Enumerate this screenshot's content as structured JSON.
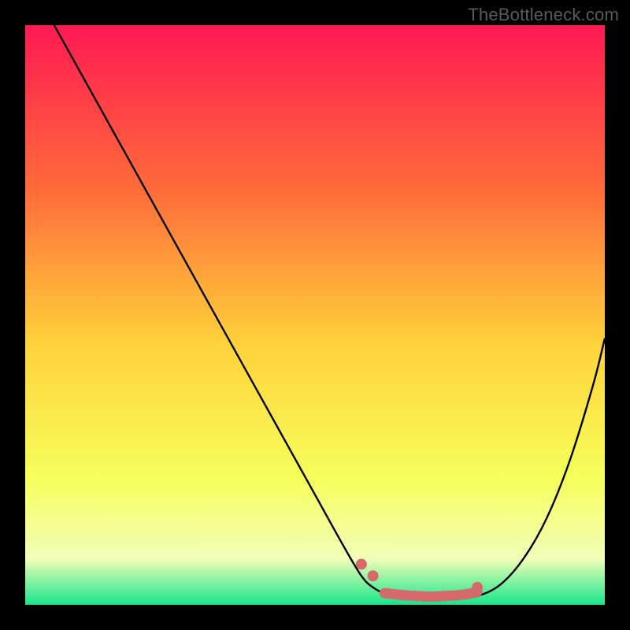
{
  "watermark": "TheBottleneck.com",
  "chart_data": {
    "type": "line",
    "title": "",
    "xlabel": "",
    "ylabel": "",
    "xlim": [
      0,
      100
    ],
    "ylim": [
      0,
      100
    ],
    "grid": false,
    "series": [
      {
        "name": "curve",
        "color": "#000000",
        "x": [
          5,
          10,
          15,
          20,
          25,
          30,
          35,
          40,
          45,
          50,
          55,
          58,
          60,
          63,
          66,
          70,
          74,
          78,
          82,
          86,
          90,
          94,
          98,
          100
        ],
        "y": [
          100,
          91,
          82,
          73,
          64,
          55,
          46,
          37,
          28,
          19,
          10,
          5,
          3,
          1.5,
          1,
          1,
          1,
          1.5,
          3.5,
          8,
          15,
          25,
          38,
          46
        ]
      }
    ],
    "markers": [
      {
        "name": "dot",
        "color": "#d66a6a",
        "x": 58,
        "y": 7
      },
      {
        "name": "dot",
        "color": "#d66a6a",
        "x": 60,
        "y": 5
      },
      {
        "name": "dot",
        "color": "#d66a6a",
        "x": 78,
        "y": 3
      }
    ],
    "thick_segment": {
      "name": "highlight",
      "color": "#d66a6a",
      "x": [
        62,
        64,
        66,
        68,
        70,
        72,
        74,
        76,
        78
      ],
      "y": [
        2,
        1.8,
        1.6,
        1.5,
        1.4,
        1.5,
        1.6,
        1.8,
        2.2
      ]
    },
    "background_gradient": {
      "top": "#ff1a52",
      "mid_upper": "#ff6a3a",
      "mid": "#ffd23a",
      "mid_lower": "#f6ff5a",
      "pale": "#f2ffb8",
      "bottom": "#17e58b"
    }
  }
}
